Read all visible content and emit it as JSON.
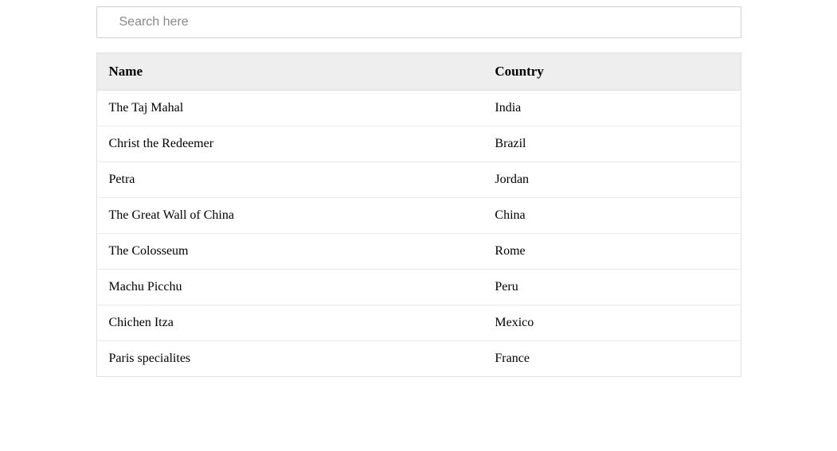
{
  "search": {
    "placeholder": "Search here",
    "value": ""
  },
  "table": {
    "headers": {
      "name": "Name",
      "country": "Country"
    },
    "rows": [
      {
        "name": "The Taj Mahal",
        "country": "India"
      },
      {
        "name": "Christ the Redeemer",
        "country": "Brazil"
      },
      {
        "name": "Petra",
        "country": "Jordan"
      },
      {
        "name": "The Great Wall of China",
        "country": "China"
      },
      {
        "name": "The Colosseum",
        "country": "Rome"
      },
      {
        "name": "Machu Picchu",
        "country": "Peru"
      },
      {
        "name": "Chichen Itza",
        "country": "Mexico"
      },
      {
        "name": "Paris specialites",
        "country": "France"
      }
    ]
  }
}
